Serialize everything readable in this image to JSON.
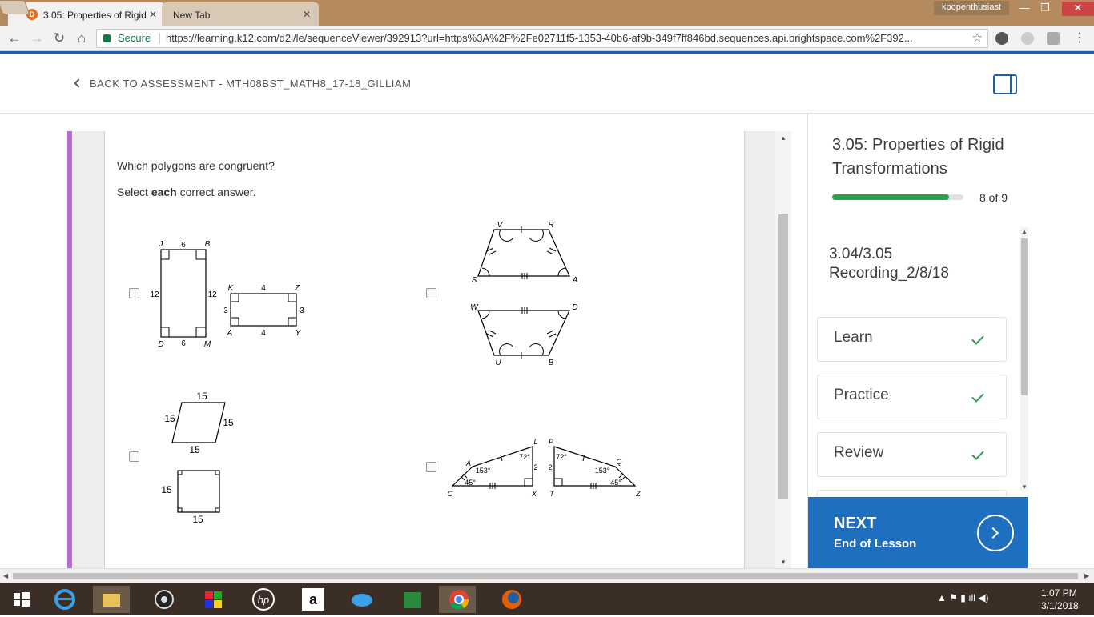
{
  "browser": {
    "tabs": [
      {
        "label": "3.05: Properties of Rigid",
        "active": true
      },
      {
        "label": "New Tab",
        "active": false
      }
    ],
    "user": "kpopenthusiast",
    "security_label": "Secure",
    "url": "https://learning.k12.com/d2l/le/sequenceViewer/392913?url=https%3A%2F%2Fe02711f5-1353-40b6-af9b-349f7ff846bd.sequences.api.brightspace.com%2F392..."
  },
  "header": {
    "back_label": "BACK TO ASSESSMENT - MTH08BST_MATH8_17-18_GILLIAM"
  },
  "question": {
    "prompt": "Which polygons are congruent?",
    "instruction_pre": "Select ",
    "instruction_bold": "each",
    "instruction_post": " correct answer.",
    "options": [
      {
        "id": "A",
        "checked": false,
        "labels": {
          "rect1": {
            "vertices": [
              "J",
              "B",
              "D",
              "M"
            ],
            "top": "6",
            "bottom": "6",
            "left": "12",
            "right": "12"
          },
          "rect2": {
            "vertices": [
              "K",
              "Z",
              "A",
              "Y"
            ],
            "top": "4",
            "bottom": "4",
            "left": "3",
            "right": "3"
          }
        }
      },
      {
        "id": "B",
        "checked": false,
        "labels": {
          "hex1": [
            "V",
            "R",
            "S",
            "A"
          ],
          "hex2": [
            "W",
            "D",
            "U",
            "B"
          ]
        }
      },
      {
        "id": "C",
        "checked": false,
        "labels": {
          "rhombus": {
            "top": "15",
            "left": "15",
            "right": "15",
            "bottom": "15"
          },
          "square": {
            "left": "15",
            "bottom": "15"
          }
        }
      },
      {
        "id": "D",
        "checked": false,
        "labels": {
          "quad1": {
            "vertices": [
              "L",
              "A",
              "C",
              "X"
            ],
            "angles": [
              "72°",
              "153°",
              "45°"
            ],
            "side": "2"
          },
          "quad2": {
            "vertices": [
              "P",
              "Q",
              "T",
              "Z"
            ],
            "angles": [
              "72°",
              "153°",
              "45°"
            ],
            "side": "2"
          }
        }
      }
    ]
  },
  "sidebar": {
    "lesson_title": "3.05: Properties of Rigid Transformations",
    "progress_text": "8 of 9",
    "progress_fraction": 0.89,
    "section_title": "3.04/3.05 Recording_2/8/18",
    "items": [
      {
        "label": "Learn",
        "done": true
      },
      {
        "label": "Practice",
        "done": true
      },
      {
        "label": "Review",
        "done": true
      }
    ],
    "next_label": "NEXT",
    "next_sub": "End of Lesson"
  },
  "taskbar": {
    "time": "1:07 PM",
    "date": "3/1/2018"
  },
  "colors": {
    "accent_blue": "#1f6fc0",
    "progress_green": "#2e9e4f",
    "purple_bar": "#b86bd6",
    "titlebar": "#b48a5e"
  }
}
